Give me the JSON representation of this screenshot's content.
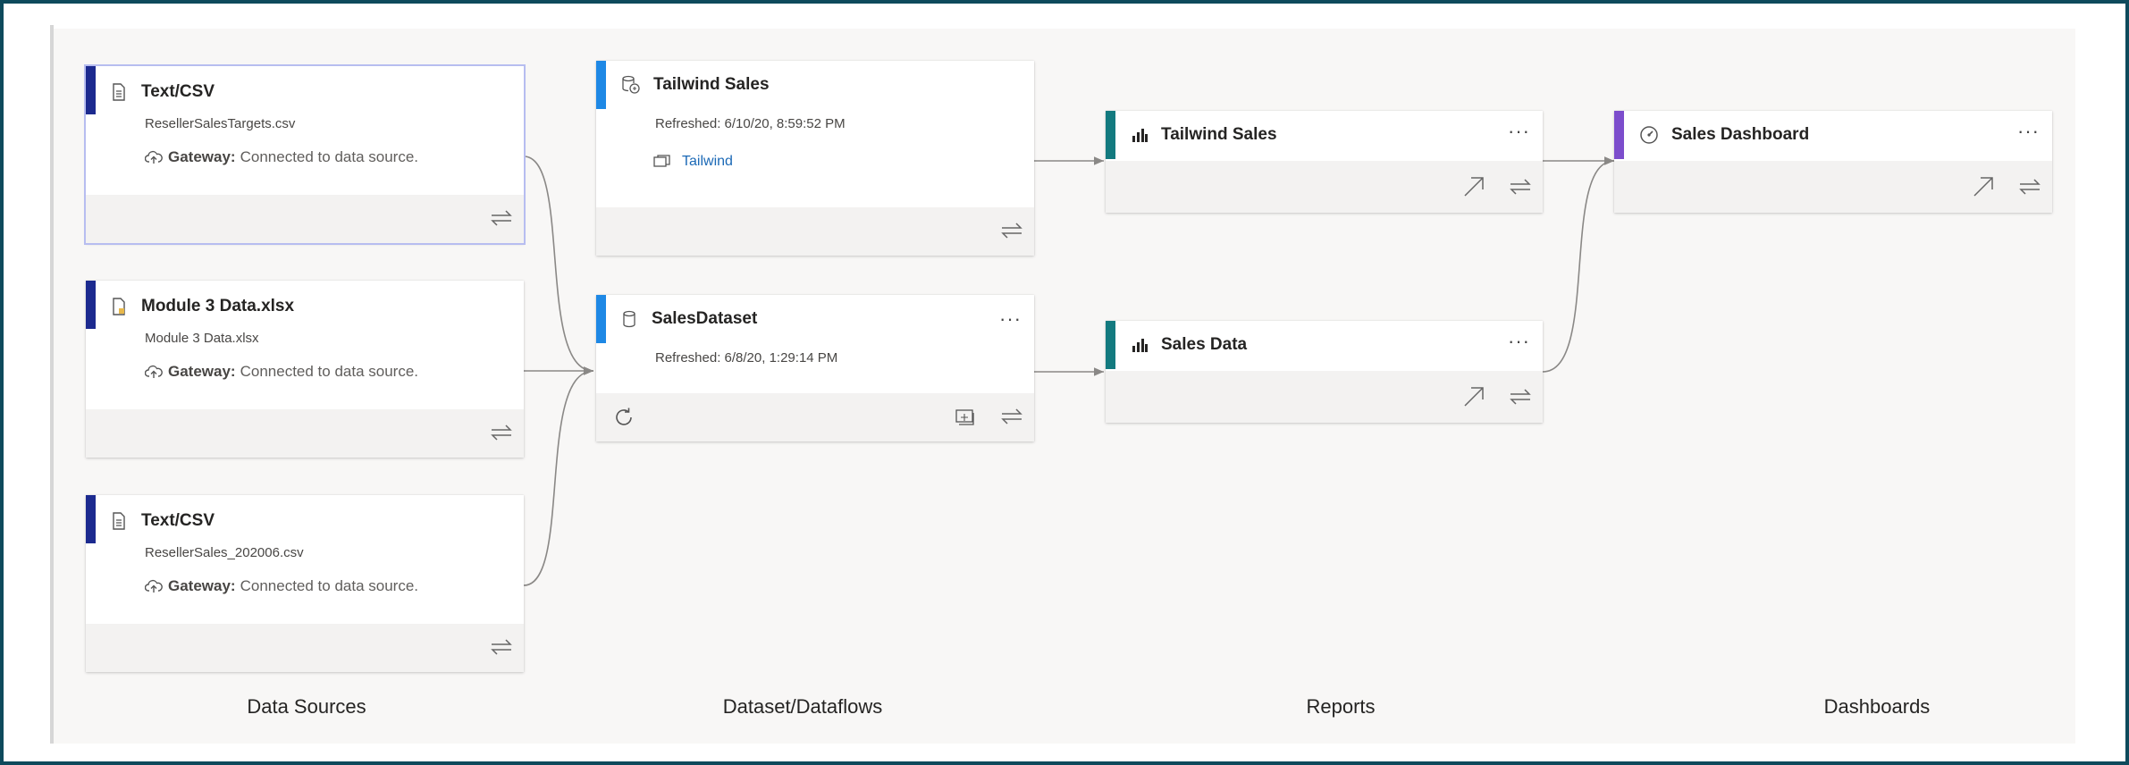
{
  "sources": [
    {
      "type": "Text/CSV",
      "file": "ResellerSalesTargets.csv",
      "gateway_label": "Gateway:",
      "gateway_status": "Connected to data source."
    },
    {
      "type": "Module 3 Data.xlsx",
      "file": "Module 3 Data.xlsx",
      "gateway_label": "Gateway:",
      "gateway_status": "Connected to data source."
    },
    {
      "type": "Text/CSV",
      "file": "ResellerSales_202006.csv",
      "gateway_label": "Gateway:",
      "gateway_status": "Connected to data source."
    }
  ],
  "datasets": [
    {
      "name": "Tailwind Sales",
      "refreshed": "Refreshed: 6/10/20, 8:59:52 PM",
      "link": "Tailwind"
    },
    {
      "name": "SalesDataset",
      "refreshed": "Refreshed: 6/8/20, 1:29:14 PM",
      "more": "···"
    }
  ],
  "reports": [
    {
      "name": "Tailwind Sales",
      "more": "···"
    },
    {
      "name": "Sales Data",
      "more": "···"
    }
  ],
  "dashboards": [
    {
      "name": "Sales Dashboard",
      "more": "···"
    }
  ],
  "columns": {
    "data_sources": "Data Sources",
    "datasets": "Dataset/Dataflows",
    "reports": "Reports",
    "dashboards": "Dashboards"
  },
  "colors": {
    "source_accent": "#1c2a8f",
    "dataset_accent": "#1e88e5",
    "report_accent": "#137a7f",
    "dashboard_accent": "#7c4dcc",
    "link": "#1b69b6"
  }
}
